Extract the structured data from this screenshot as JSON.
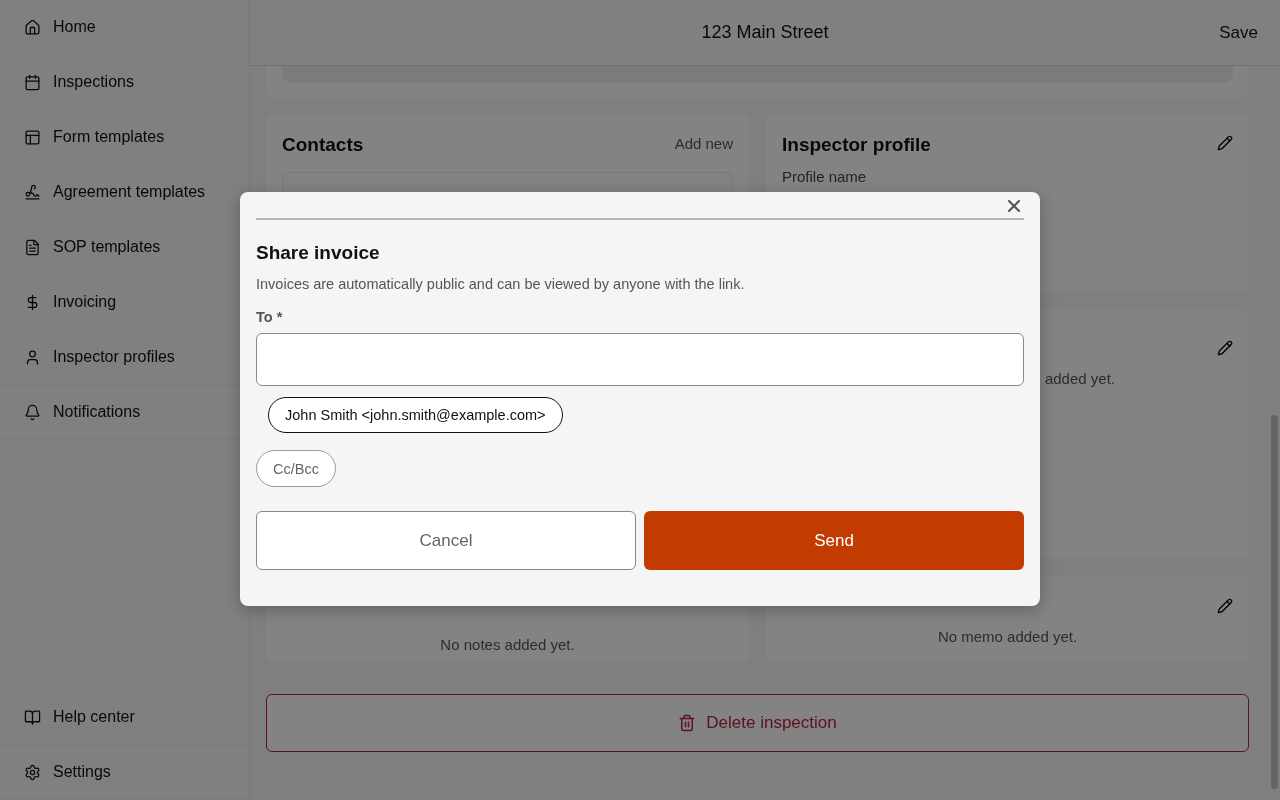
{
  "sidebar": {
    "items": [
      {
        "label": "Home"
      },
      {
        "label": "Inspections"
      },
      {
        "label": "Form templates"
      },
      {
        "label": "Agreement templates"
      },
      {
        "label": "SOP templates"
      },
      {
        "label": "Invoicing"
      },
      {
        "label": "Inspector profiles"
      },
      {
        "label": "Notifications"
      }
    ],
    "footer_items": [
      {
        "label": "Help center"
      },
      {
        "label": "Settings"
      }
    ]
  },
  "header": {
    "title": "123 Main Street",
    "action": "Save"
  },
  "cards": {
    "contacts": {
      "title": "Contacts",
      "action": "Add new"
    },
    "inspector_profile": {
      "title": "Inspector profile",
      "field_label": "Profile name"
    },
    "card_3": {
      "text": "added yet."
    },
    "notes": {
      "text": "No notes added yet."
    },
    "memo": {
      "text": "No memo added yet."
    }
  },
  "delete_button": "Delete inspection",
  "dialog": {
    "title": "Share invoice",
    "description": "Invoices are automatically public and can be viewed by anyone with the link.",
    "to_label": "To *",
    "recipients": [
      "John Smith <john.smith@example.com>"
    ],
    "cc_button": "Cc/Bcc",
    "buttons": [
      {
        "kind": "secondary",
        "label": "Cancel"
      },
      {
        "kind": "primary",
        "label": "Send"
      }
    ]
  }
}
